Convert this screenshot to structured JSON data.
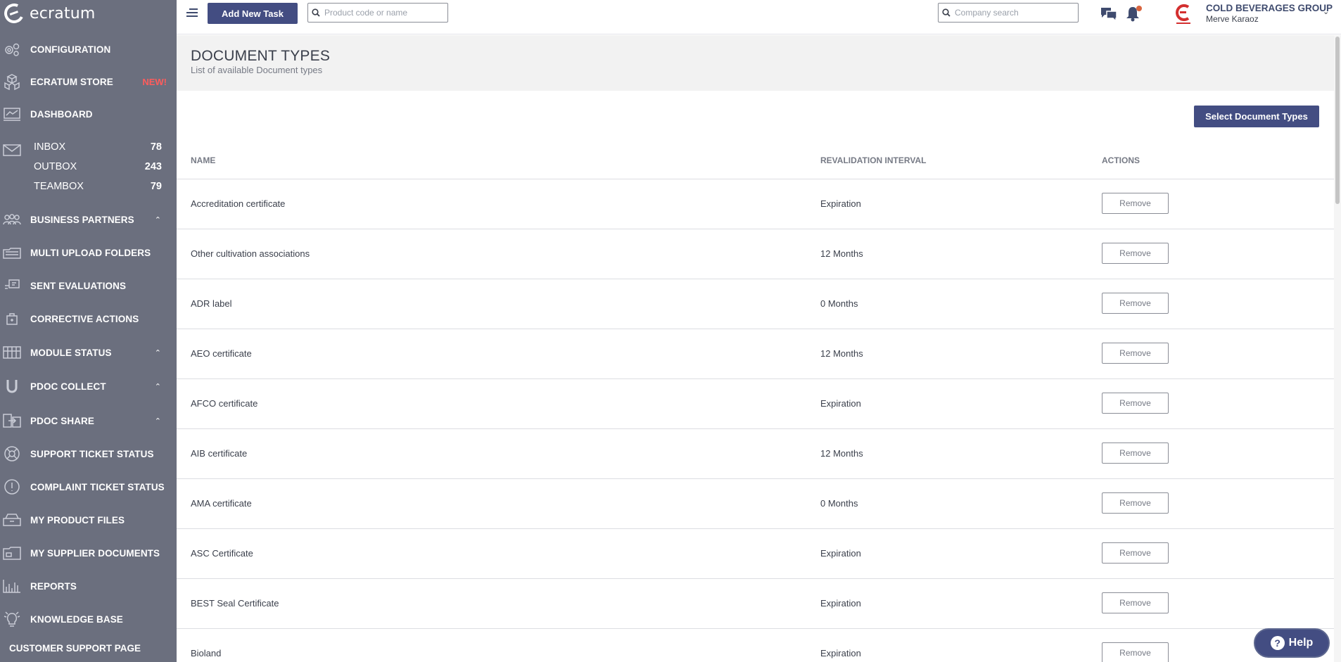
{
  "app": {
    "logo_text": "ecratum"
  },
  "sidebar": {
    "items": [
      {
        "id": "configuration",
        "label": "CONFIGURATION",
        "icon": "gears-icon"
      },
      {
        "id": "store",
        "label": "ECRATUM STORE",
        "badge": "NEW!",
        "icon": "cubes-icon"
      },
      {
        "id": "dashboard",
        "label": "DASHBOARD",
        "icon": "dashboard-icon"
      },
      {
        "id": "business-partners",
        "label": "BUSINESS PARTNERS",
        "icon": "people-icon"
      },
      {
        "id": "multi-upload",
        "label": "MULTI UPLOAD FOLDERS",
        "icon": "folders-icon"
      },
      {
        "id": "sent-evaluations",
        "label": "SENT EVALUATIONS",
        "icon": "evaluation-icon"
      },
      {
        "id": "corrective-actions",
        "label": "CORRECTIVE ACTIONS",
        "icon": "briefcase-icon"
      },
      {
        "id": "module-status",
        "label": "MODULE STATUS",
        "icon": "module-grid-icon"
      },
      {
        "id": "pdoc-collect",
        "label": "PDOC COLLECT",
        "icon": "magnet-icon"
      },
      {
        "id": "pdoc-share",
        "label": "PDOC SHARE",
        "icon": "share-icon"
      },
      {
        "id": "support-ticket",
        "label": "SUPPORT TICKET STATUS",
        "icon": "lifebuoy-icon"
      },
      {
        "id": "complaint-ticket",
        "label": "COMPLAINT TICKET STATUS",
        "icon": "alert-icon"
      },
      {
        "id": "product-files",
        "label": "MY PRODUCT FILES",
        "icon": "drawer-icon"
      },
      {
        "id": "supplier-docs",
        "label": "MY SUPPLIER DOCUMENTS",
        "icon": "folder-icon"
      },
      {
        "id": "reports",
        "label": "REPORTS",
        "icon": "bar-chart-icon"
      },
      {
        "id": "knowledge-base",
        "label": "KNOWLEDGE BASE",
        "icon": "lightbulb-icon"
      }
    ],
    "mail": [
      {
        "label": "INBOX",
        "count": "78"
      },
      {
        "label": "OUTBOX",
        "count": "243"
      },
      {
        "label": "TEAMBOX",
        "count": "79"
      }
    ],
    "support_page": "CUSTOMER SUPPORT PAGE"
  },
  "topbar": {
    "add_task_label": "Add New Task",
    "product_search_placeholder": "Product code or name",
    "company_search_placeholder": "Company search",
    "company_name": "COLD BEVERAGES GROUP",
    "user_name": "Merve Karaoz"
  },
  "page": {
    "title": "DOCUMENT TYPES",
    "subtitle": "List of available Document types",
    "select_button": "Select Document Types"
  },
  "table": {
    "columns": {
      "name": "NAME",
      "interval": "REVALIDATION INTERVAL",
      "actions": "ACTIONS"
    },
    "remove_label": "Remove",
    "rows": [
      {
        "name": "Accreditation certificate",
        "interval": "Expiration"
      },
      {
        "name": "Other cultivation associations",
        "interval": "12 Months"
      },
      {
        "name": "ADR label",
        "interval": "0 Months"
      },
      {
        "name": "AEO certificate",
        "interval": "12 Months"
      },
      {
        "name": "AFCO certificate",
        "interval": "Expiration"
      },
      {
        "name": "AIB certificate",
        "interval": "12 Months"
      },
      {
        "name": "AMA certificate",
        "interval": "0 Months"
      },
      {
        "name": "ASC Certificate",
        "interval": "Expiration"
      },
      {
        "name": "BEST Seal Certificate",
        "interval": "Expiration"
      },
      {
        "name": "Bioland",
        "interval": "Expiration"
      }
    ]
  },
  "help": {
    "label": "Help"
  },
  "colors": {
    "sidebar_bg": "#6b6f7e",
    "primary": "#434d82",
    "new_badge": "#ff5c5c",
    "notification_dot": "#d9653f",
    "company_logo": "#d32f2f"
  }
}
